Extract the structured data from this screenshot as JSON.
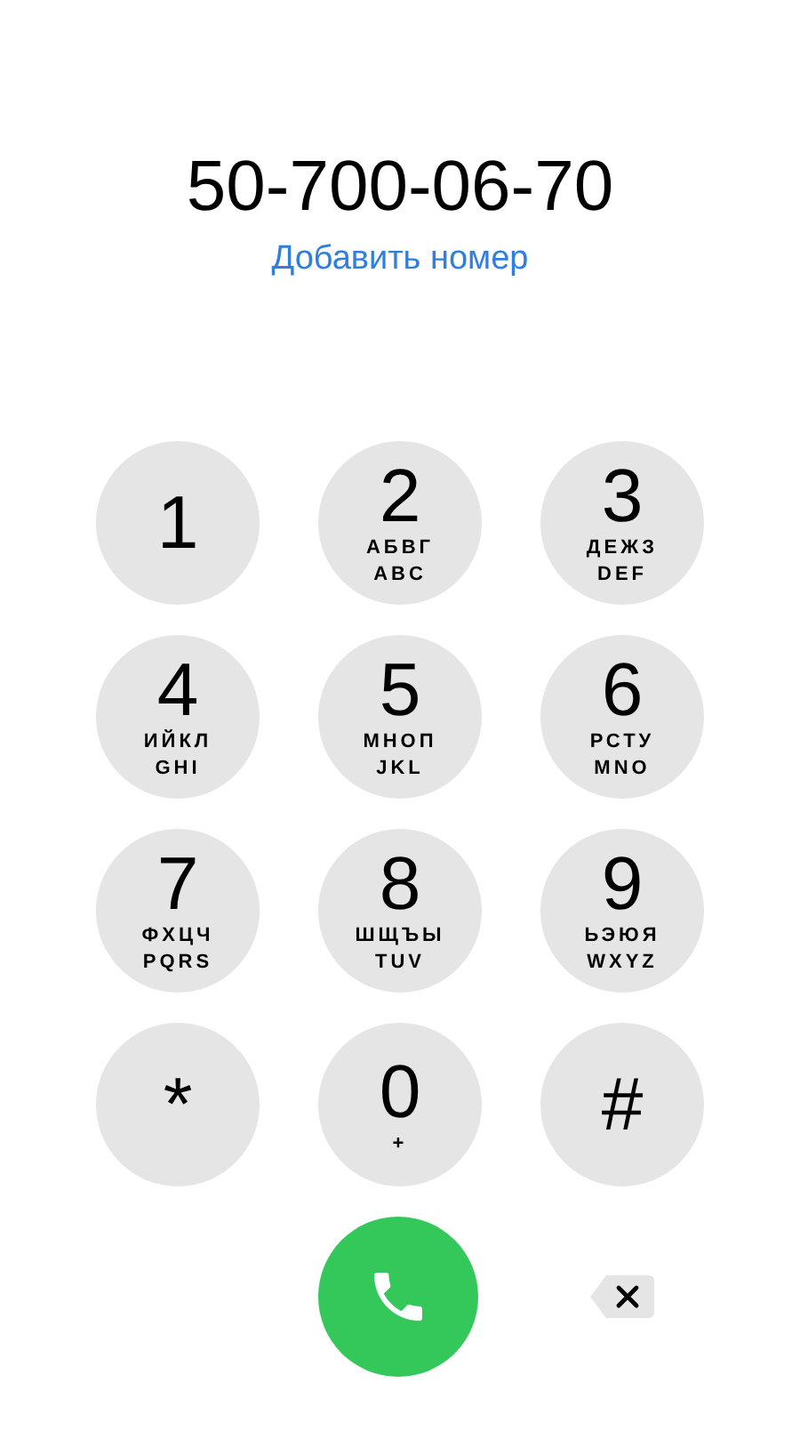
{
  "dialed_number": "50-700-06-70",
  "add_number_link": "Добавить номер",
  "keys": [
    {
      "digit": "1"
    },
    {
      "digit": "2",
      "letters": [
        "АБВГ",
        "ABC"
      ]
    },
    {
      "digit": "3",
      "letters": [
        "ДЕЖЗ",
        "DEF"
      ]
    },
    {
      "digit": "4",
      "letters": [
        "ИЙКЛ",
        "GHI"
      ]
    },
    {
      "digit": "5",
      "letters": [
        "МНОП",
        "JKL"
      ]
    },
    {
      "digit": "6",
      "letters": [
        "РСТУ",
        "MNO"
      ]
    },
    {
      "digit": "7",
      "letters": [
        "ФХЦЧ",
        "PQRS"
      ]
    },
    {
      "digit": "8",
      "letters": [
        "ШЩЪЫ",
        "TUV"
      ]
    },
    {
      "digit": "9",
      "letters": [
        "ЬЭЮЯ",
        "WXYZ"
      ]
    },
    {
      "digit": "*"
    },
    {
      "digit": "0",
      "letters": [
        "+"
      ]
    },
    {
      "digit": "#"
    }
  ]
}
